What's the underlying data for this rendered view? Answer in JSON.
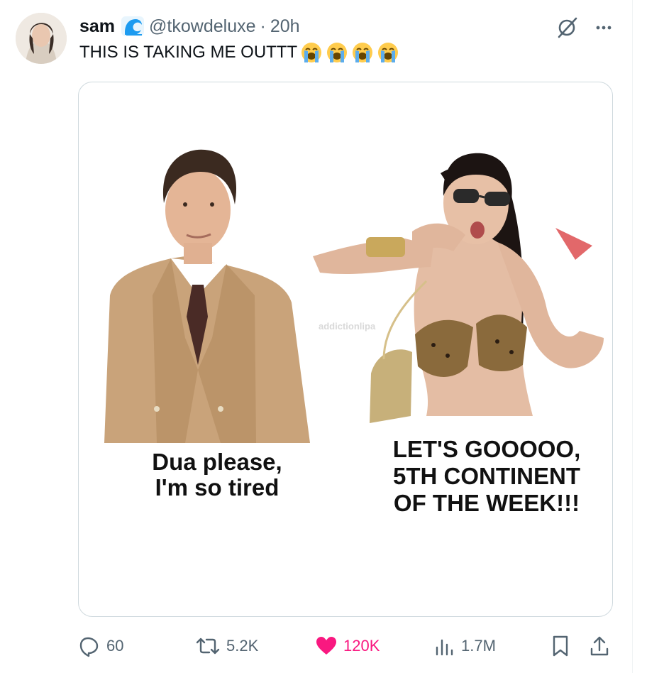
{
  "tweet": {
    "display_name": "sam",
    "handle": "@tkowdeluxe",
    "separator": "·",
    "time": "20h",
    "text": "THIS IS TAKING ME OUTTT",
    "emoji_count": 4
  },
  "media": {
    "left_caption": [
      "Dua please,",
      "I'm so tired"
    ],
    "right_caption": [
      "LET'S GOOOOO,",
      "5TH CONTINENT",
      "OF THE WEEK!!!"
    ],
    "watermark": "addictionlipa"
  },
  "actions": {
    "replies": "60",
    "reposts": "5.2K",
    "likes": "120K",
    "views": "1.7M"
  },
  "colors": {
    "like": "#f91880",
    "secondary_text": "#536471",
    "verified_badge": "#1d9bf0",
    "border": "#cfd9de"
  }
}
